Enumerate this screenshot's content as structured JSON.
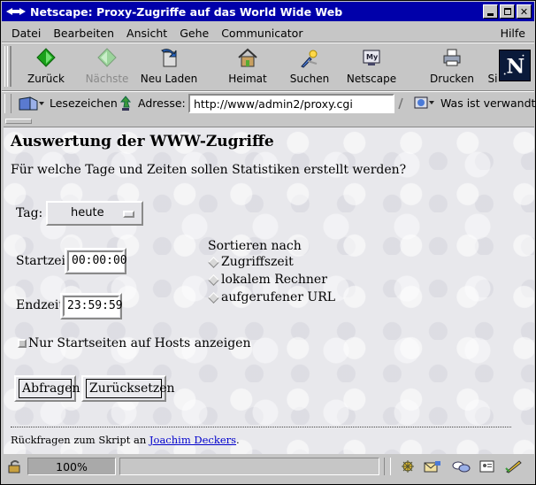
{
  "window": {
    "title": "Netscape: Proxy-Zugriffe auf das World Wide Web",
    "controls": [
      "minimize",
      "maximize",
      "close"
    ]
  },
  "menu": {
    "items": [
      "Datei",
      "Bearbeiten",
      "Ansicht",
      "Gehe",
      "Communicator"
    ],
    "help": "Hilfe"
  },
  "toolbar": {
    "back": "Zurück",
    "forward": "Nächste",
    "reload": "Neu Laden",
    "home": "Heimat",
    "search": "Suchen",
    "netscape": "Netscape",
    "print": "Drucken",
    "security": "Si"
  },
  "location": {
    "bookmarks": "Lesezeichen",
    "address_label": "Adresse:",
    "url": "http://www/admin2/proxy.cgi",
    "whats_related": "Was ist verwandt"
  },
  "page": {
    "heading": "Auswertung der WWW-Zugriffe",
    "question": "Für welche Tage und Zeiten sollen Statistiken erstellt werden?",
    "day_label": "Tag:",
    "day_value": "heute",
    "start_label": "Startzeit:",
    "start_value": "00:00:00",
    "end_label": "Endzeit:",
    "end_value": "23:59:59",
    "sort_heading": "Sortieren nach",
    "sort_options": [
      "Zugriffszeit",
      "lokalem Rechner",
      "aufgerufener URL"
    ],
    "checkbox_label": "Nur Startseiten auf Hosts anzeigen",
    "submit": "Abfragen",
    "reset": "Zurücksetzen",
    "footer_text": "Rückfragen zum Skript an ",
    "footer_link": "Joachim Deckers",
    "footer_end": "."
  },
  "status": {
    "progress": "100%"
  }
}
